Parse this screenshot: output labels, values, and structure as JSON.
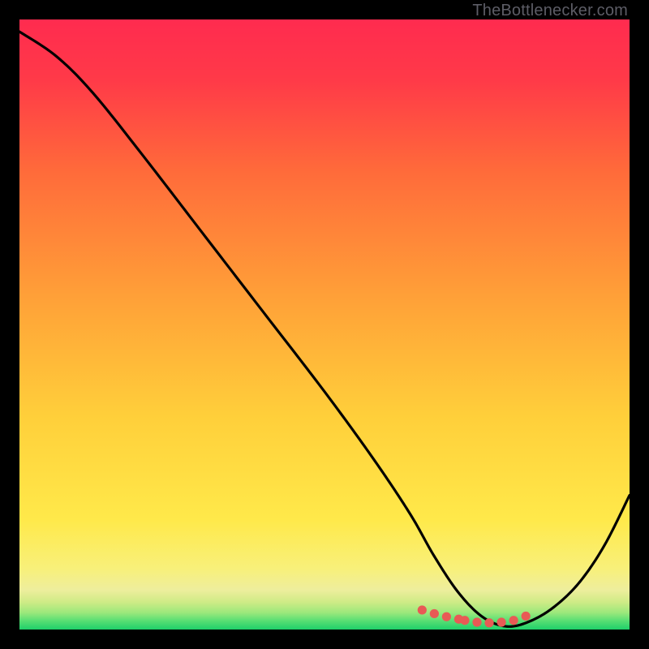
{
  "watermark": "TheBottlenecker.com",
  "colors": {
    "top": "#ff2b4f",
    "mid": "#ffde3b",
    "bottom_band_1": "#f6ee9c",
    "bottom_band_2": "#c8eb80",
    "bottom_band_3": "#7de577",
    "bottom_band_4": "#28d46a",
    "curve": "#000000",
    "dots": "#e85a55",
    "background": "#000000"
  },
  "chart_data": {
    "type": "line",
    "title": "",
    "xlabel": "",
    "ylabel": "",
    "xlim": [
      0,
      100
    ],
    "ylim": [
      0,
      100
    ],
    "grid": false,
    "legend": false,
    "x": [
      0,
      6,
      12,
      20,
      30,
      40,
      50,
      58,
      64,
      68,
      72,
      76,
      80,
      84,
      88,
      92,
      96,
      100
    ],
    "values": [
      98,
      94,
      88,
      78,
      65,
      52,
      39,
      28,
      19,
      12,
      6,
      2,
      0.5,
      1.5,
      4,
      8,
      14,
      22
    ],
    "notes": "Single black bottleneck curve on a rainbow vertical gradient background. Red data-point markers cluster near the minimum (x≈68–84, y≈0–3).",
    "markers": [
      {
        "x": 66,
        "y": 3.2
      },
      {
        "x": 68,
        "y": 2.6
      },
      {
        "x": 70,
        "y": 2.1
      },
      {
        "x": 72,
        "y": 1.7
      },
      {
        "x": 73,
        "y": 1.5
      },
      {
        "x": 75,
        "y": 1.2
      },
      {
        "x": 77,
        "y": 1.1
      },
      {
        "x": 79,
        "y": 1.2
      },
      {
        "x": 81,
        "y": 1.5
      },
      {
        "x": 83,
        "y": 2.2
      }
    ]
  }
}
